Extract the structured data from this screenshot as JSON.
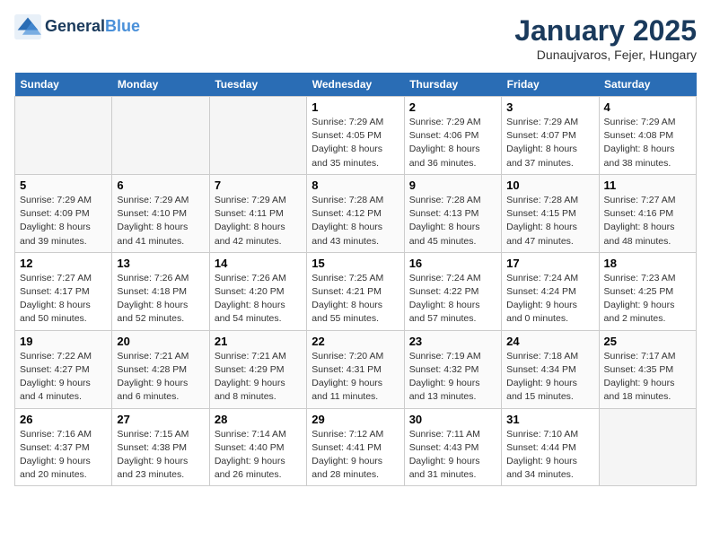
{
  "header": {
    "logo_line1": "General",
    "logo_line2": "Blue",
    "month": "January 2025",
    "location": "Dunaujvaros, Fejer, Hungary"
  },
  "days_of_week": [
    "Sunday",
    "Monday",
    "Tuesday",
    "Wednesday",
    "Thursday",
    "Friday",
    "Saturday"
  ],
  "weeks": [
    [
      {
        "day": "",
        "detail": ""
      },
      {
        "day": "",
        "detail": ""
      },
      {
        "day": "",
        "detail": ""
      },
      {
        "day": "1",
        "detail": "Sunrise: 7:29 AM\nSunset: 4:05 PM\nDaylight: 8 hours and 35 minutes."
      },
      {
        "day": "2",
        "detail": "Sunrise: 7:29 AM\nSunset: 4:06 PM\nDaylight: 8 hours and 36 minutes."
      },
      {
        "day": "3",
        "detail": "Sunrise: 7:29 AM\nSunset: 4:07 PM\nDaylight: 8 hours and 37 minutes."
      },
      {
        "day": "4",
        "detail": "Sunrise: 7:29 AM\nSunset: 4:08 PM\nDaylight: 8 hours and 38 minutes."
      }
    ],
    [
      {
        "day": "5",
        "detail": "Sunrise: 7:29 AM\nSunset: 4:09 PM\nDaylight: 8 hours and 39 minutes."
      },
      {
        "day": "6",
        "detail": "Sunrise: 7:29 AM\nSunset: 4:10 PM\nDaylight: 8 hours and 41 minutes."
      },
      {
        "day": "7",
        "detail": "Sunrise: 7:29 AM\nSunset: 4:11 PM\nDaylight: 8 hours and 42 minutes."
      },
      {
        "day": "8",
        "detail": "Sunrise: 7:28 AM\nSunset: 4:12 PM\nDaylight: 8 hours and 43 minutes."
      },
      {
        "day": "9",
        "detail": "Sunrise: 7:28 AM\nSunset: 4:13 PM\nDaylight: 8 hours and 45 minutes."
      },
      {
        "day": "10",
        "detail": "Sunrise: 7:28 AM\nSunset: 4:15 PM\nDaylight: 8 hours and 47 minutes."
      },
      {
        "day": "11",
        "detail": "Sunrise: 7:27 AM\nSunset: 4:16 PM\nDaylight: 8 hours and 48 minutes."
      }
    ],
    [
      {
        "day": "12",
        "detail": "Sunrise: 7:27 AM\nSunset: 4:17 PM\nDaylight: 8 hours and 50 minutes."
      },
      {
        "day": "13",
        "detail": "Sunrise: 7:26 AM\nSunset: 4:18 PM\nDaylight: 8 hours and 52 minutes."
      },
      {
        "day": "14",
        "detail": "Sunrise: 7:26 AM\nSunset: 4:20 PM\nDaylight: 8 hours and 54 minutes."
      },
      {
        "day": "15",
        "detail": "Sunrise: 7:25 AM\nSunset: 4:21 PM\nDaylight: 8 hours and 55 minutes."
      },
      {
        "day": "16",
        "detail": "Sunrise: 7:24 AM\nSunset: 4:22 PM\nDaylight: 8 hours and 57 minutes."
      },
      {
        "day": "17",
        "detail": "Sunrise: 7:24 AM\nSunset: 4:24 PM\nDaylight: 9 hours and 0 minutes."
      },
      {
        "day": "18",
        "detail": "Sunrise: 7:23 AM\nSunset: 4:25 PM\nDaylight: 9 hours and 2 minutes."
      }
    ],
    [
      {
        "day": "19",
        "detail": "Sunrise: 7:22 AM\nSunset: 4:27 PM\nDaylight: 9 hours and 4 minutes."
      },
      {
        "day": "20",
        "detail": "Sunrise: 7:21 AM\nSunset: 4:28 PM\nDaylight: 9 hours and 6 minutes."
      },
      {
        "day": "21",
        "detail": "Sunrise: 7:21 AM\nSunset: 4:29 PM\nDaylight: 9 hours and 8 minutes."
      },
      {
        "day": "22",
        "detail": "Sunrise: 7:20 AM\nSunset: 4:31 PM\nDaylight: 9 hours and 11 minutes."
      },
      {
        "day": "23",
        "detail": "Sunrise: 7:19 AM\nSunset: 4:32 PM\nDaylight: 9 hours and 13 minutes."
      },
      {
        "day": "24",
        "detail": "Sunrise: 7:18 AM\nSunset: 4:34 PM\nDaylight: 9 hours and 15 minutes."
      },
      {
        "day": "25",
        "detail": "Sunrise: 7:17 AM\nSunset: 4:35 PM\nDaylight: 9 hours and 18 minutes."
      }
    ],
    [
      {
        "day": "26",
        "detail": "Sunrise: 7:16 AM\nSunset: 4:37 PM\nDaylight: 9 hours and 20 minutes."
      },
      {
        "day": "27",
        "detail": "Sunrise: 7:15 AM\nSunset: 4:38 PM\nDaylight: 9 hours and 23 minutes."
      },
      {
        "day": "28",
        "detail": "Sunrise: 7:14 AM\nSunset: 4:40 PM\nDaylight: 9 hours and 26 minutes."
      },
      {
        "day": "29",
        "detail": "Sunrise: 7:12 AM\nSunset: 4:41 PM\nDaylight: 9 hours and 28 minutes."
      },
      {
        "day": "30",
        "detail": "Sunrise: 7:11 AM\nSunset: 4:43 PM\nDaylight: 9 hours and 31 minutes."
      },
      {
        "day": "31",
        "detail": "Sunrise: 7:10 AM\nSunset: 4:44 PM\nDaylight: 9 hours and 34 minutes."
      },
      {
        "day": "",
        "detail": ""
      }
    ]
  ]
}
